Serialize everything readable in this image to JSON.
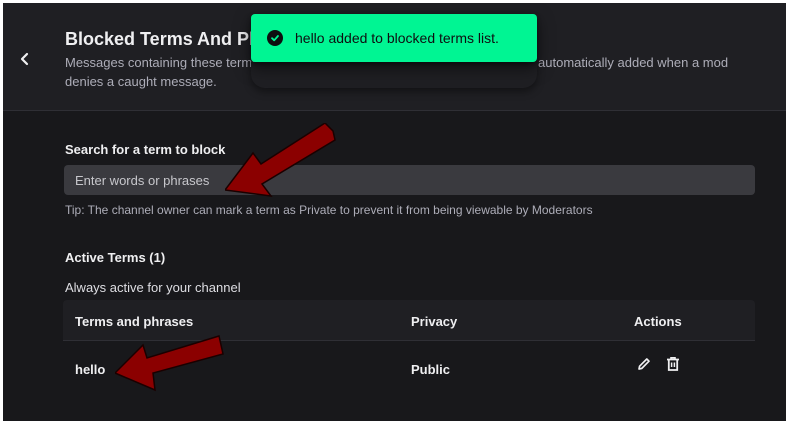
{
  "header": {
    "title": "Blocked Terms And Phrases",
    "description": "Messages containing these terms or phrases will be blocked from chat. Terms are automatically added when a mod denies a caught message."
  },
  "toast": {
    "message": "hello added to blocked terms list.",
    "accent_color": "#00f593"
  },
  "search": {
    "label": "Search for a term to block",
    "placeholder": "Enter words or phrases",
    "tip": "Tip: The channel owner can mark a term as Private to prevent it from being viewable by Moderators"
  },
  "active_terms": {
    "heading": "Active Terms (1)",
    "subheading": "Always active for your channel",
    "columns": [
      "Terms and phrases",
      "Privacy",
      "Actions"
    ],
    "rows": [
      {
        "term": "hello",
        "privacy": "Public",
        "actions": [
          "pencil-icon",
          "trash-icon"
        ]
      }
    ]
  },
  "annotations": {
    "arrow_color": "#8b0000"
  },
  "icons": {
    "back": "chevron-left-icon",
    "toast": "checkmark-circle-icon"
  }
}
